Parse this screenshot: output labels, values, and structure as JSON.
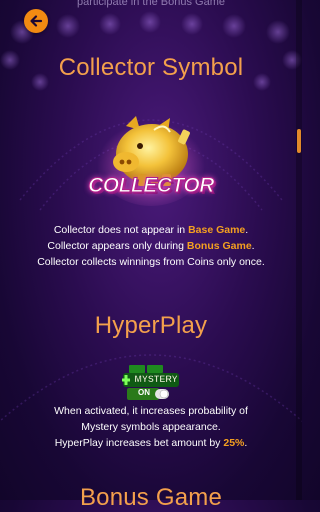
{
  "header": {
    "cut_text": "participate in the Bonus Game",
    "back_icon": "arrow-left-icon"
  },
  "collector": {
    "title": "Collector Symbol",
    "icon": "piggy-bank-collector-icon",
    "icon_label": "COLLECTOR",
    "line1_pre": "Collector does not appear in ",
    "line1_hl": "Base Game",
    "line1_post": ".",
    "line2_pre": "Collector appears only during ",
    "line2_hl": "Bonus Game",
    "line2_post": ".",
    "line3": "Collector collects winnings from Coins only once."
  },
  "hyperplay": {
    "title": "HyperPlay",
    "icon": "free-mystery-toggle-icon",
    "icon_label_top": "MYSTERY",
    "icon_label_toggle": "ON",
    "line1": "When activated, it increases probability of",
    "line2": "Mystery symbols appearance.",
    "line3_pre": "HyperPlay increases bet amount by ",
    "line3_hl": "25%",
    "line3_post": "."
  },
  "next_section": {
    "title": "Bonus Game"
  },
  "colors": {
    "title": "#f3a04c",
    "highlight": "#f4a020",
    "button": "#f28a12",
    "background": "#2a0c4f"
  }
}
